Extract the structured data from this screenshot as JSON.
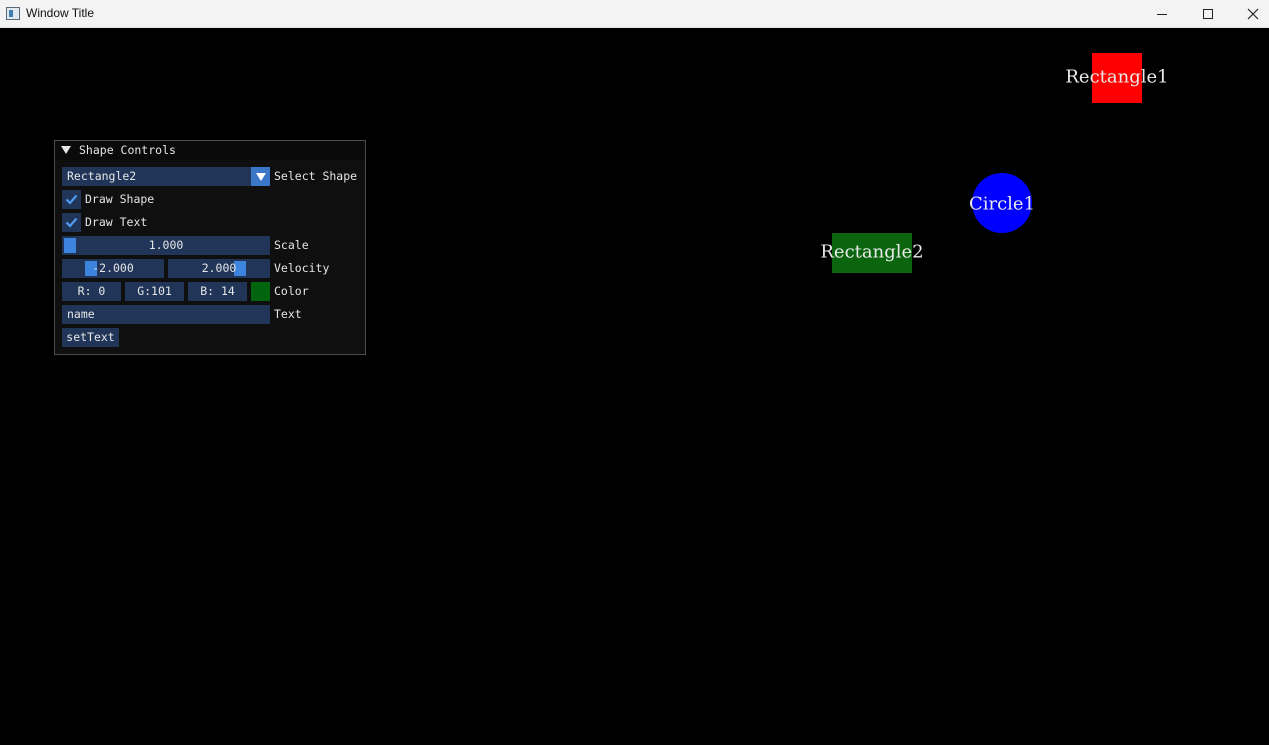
{
  "window": {
    "title": "Window Title",
    "controls": [
      "minimize",
      "maximize",
      "close"
    ]
  },
  "shapes": [
    {
      "name": "Rectangle1",
      "type": "rectangle",
      "color": "#ff0000"
    },
    {
      "name": "Circle1",
      "type": "circle",
      "color": "#0000ff"
    },
    {
      "name": "Rectangle2",
      "type": "rectangle",
      "color": "#0a650e"
    }
  ],
  "panel": {
    "title": "Shape Controls",
    "select": {
      "value": "Rectangle2",
      "label": "Select Shape"
    },
    "draw_shape": {
      "label": "Draw Shape",
      "checked": true
    },
    "draw_text": {
      "label": "Draw Text",
      "checked": true
    },
    "scale": {
      "value": "1.000",
      "label": "Scale"
    },
    "velocity": {
      "x": "-2.000",
      "y": "2.000",
      "label": "Velocity"
    },
    "color": {
      "r": "R:  0",
      "g": "G:101",
      "b": "B: 14",
      "label": "Color",
      "swatch": "#00650e"
    },
    "text": {
      "value": "name",
      "label": "Text"
    },
    "set_text_button": "setText"
  },
  "colors": {
    "frame_bg": "#203558",
    "accent": "#3d84df",
    "panel_bg": "#0f0f0f"
  }
}
